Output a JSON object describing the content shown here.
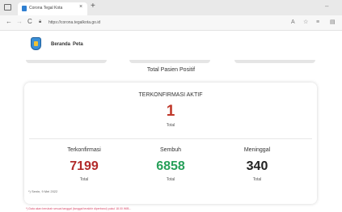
{
  "browser": {
    "tab_title": "Corona Tegal Kota",
    "tab_close": "×",
    "new_tab": "+",
    "minimize": "–",
    "back": "←",
    "forward": "→",
    "reload": "C",
    "url": "https://corona.tegalkota.go.id"
  },
  "site": {
    "nav": [
      "Beranda",
      "Peta"
    ]
  },
  "main": {
    "section_title": "Total Pasien Positif",
    "active": {
      "label": "TERKONFIRMASI AKTIF",
      "value": "1",
      "unit": "Total"
    },
    "stats": [
      {
        "label": "Terkonfirmasi",
        "value": "7199",
        "unit": "Total",
        "color": "#b22a2a"
      },
      {
        "label": "Sembuh",
        "value": "6858",
        "unit": "Total",
        "color": "#27a05a"
      },
      {
        "label": "Meninggal",
        "value": "340",
        "unit": "Total",
        "color": "#222222"
      }
    ],
    "update_text": "*) Senin, 9 Mei 2022"
  },
  "footnote": "*) Data akan berubah sesuai tanggal (tanggal terakhir diperbarui) pukul 18.00 WIB..."
}
